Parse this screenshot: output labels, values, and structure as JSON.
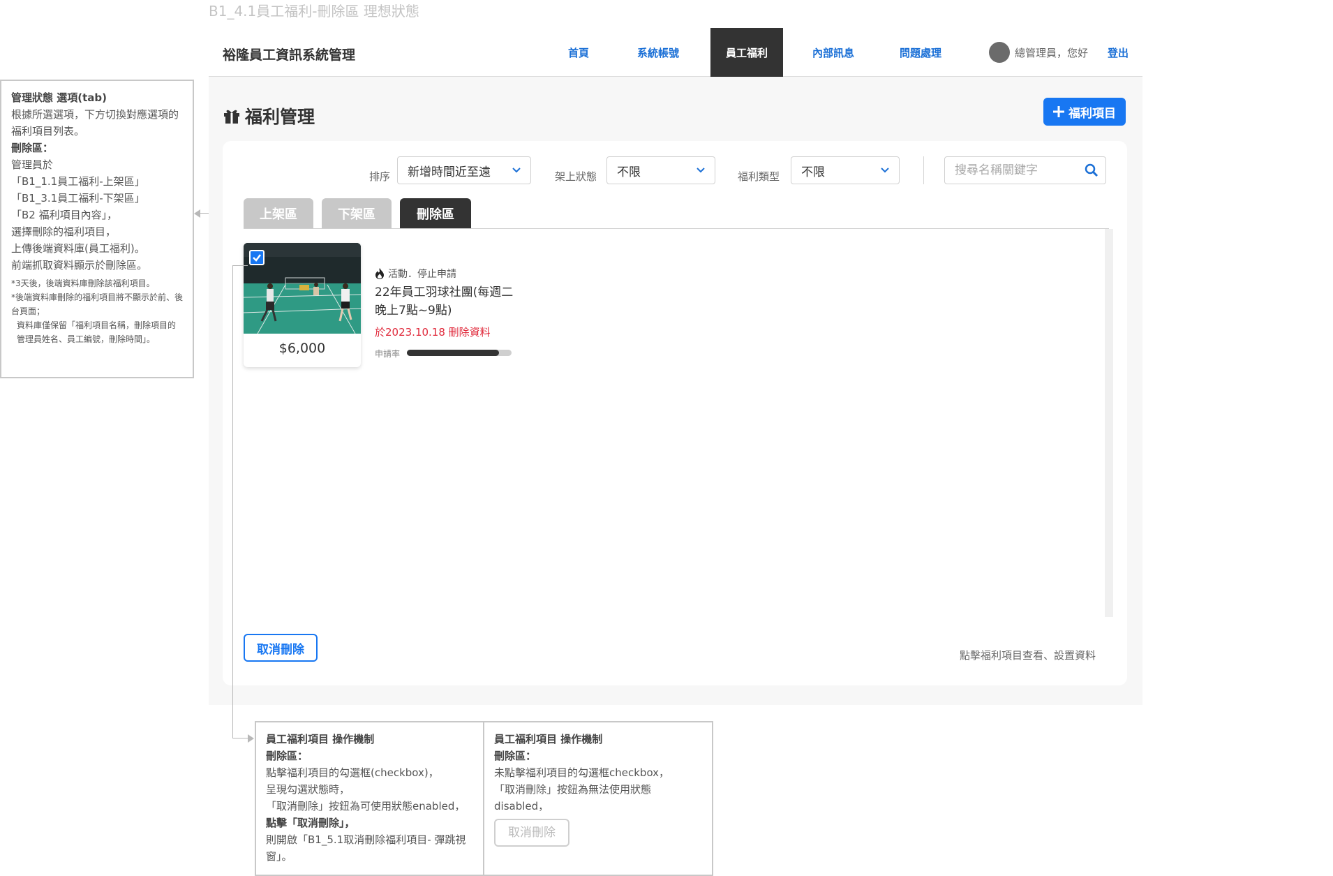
{
  "frame_title": "B1_4.1員工福利-刪除區 理想狀態",
  "header": {
    "brand": "裕隆員工資訊系統管理",
    "nav": [
      "首頁",
      "系統帳號",
      "員工福利",
      "內部訊息",
      "問題處理"
    ],
    "active_nav": "員工福利",
    "greeting": "總管理員，您好",
    "logout": "登出"
  },
  "page": {
    "title": "福利管理",
    "add_button": "福利項目"
  },
  "filters": {
    "sort_label": "排序",
    "sort_value": "新增時間近至遠",
    "shelf_label": "架上狀態",
    "shelf_value": "不限",
    "type_label": "福利類型",
    "type_value": "不限",
    "search_placeholder": "搜尋名稱關鍵字"
  },
  "tabs": [
    "上架區",
    "下架區",
    "刪除區"
  ],
  "active_tab": "刪除區",
  "items": [
    {
      "price": "$6,000",
      "category": "活動．停止申請",
      "title": "22年員工羽球社團(每週二晚上7點~9點)",
      "deleted_date": "於2023.10.18",
      "deleted_text": "刪除資料",
      "rate_label": "申請率",
      "rate": 0.88,
      "checked": true
    }
  ],
  "actions": {
    "cancel_delete": "取消刪除",
    "hint": "點擊福利項目查看、設置資料"
  },
  "annotations": {
    "left": {
      "title": "管理狀態 選項(tab)",
      "line1": "根據所選選項，下方切換對應選項的福利項目列表。",
      "sub": "刪除區：",
      "line2": "管理員於",
      "ref1": "「B1_1.1員工福利-上架區」",
      "ref2": "「B1_3.1員工福利-下架區」",
      "ref3": "「B2 福利項目內容」，",
      "line3": "選擇刪除的福利項目，",
      "line4": "上傳後端資料庫(員工福利)。",
      "line5": "前端抓取資料顯示於刪除區。",
      "note1": "*3天後，後端資料庫刪除該福利項目。",
      "note2": "*後端資料庫刪除的福利項目將不顯示於前、後台頁面；",
      "note3": "資料庫僅保留「福利項目名稱，刪除項目的管理員姓名、員工編號，刪除時間」。"
    },
    "bottom1": {
      "title": "員工福利項目 操作機制",
      "sub": "刪除區：",
      "l1": "點擊福利項目的勾選框(checkbox)，",
      "l2": "呈現勾選狀態時，",
      "l3": "「取消刪除」按鈕為可使用狀態enabled，",
      "l4": "點擊「取消刪除」，",
      "l5": "則開啟「B1_5.1取消刪除福利項目- 彈跳視窗」。"
    },
    "bottom2": {
      "title": "員工福利項目 操作機制",
      "sub": "刪除區：",
      "l1": "未點擊福利項目的勾選框checkbox，",
      "l2": "「取消刪除」按鈕為無法使用狀態",
      "l3": "disabled，",
      "button": "取消刪除"
    }
  },
  "colors": {
    "accent": "#1877f2",
    "nav_active": "#333333",
    "delete_red": "#e0283a"
  }
}
